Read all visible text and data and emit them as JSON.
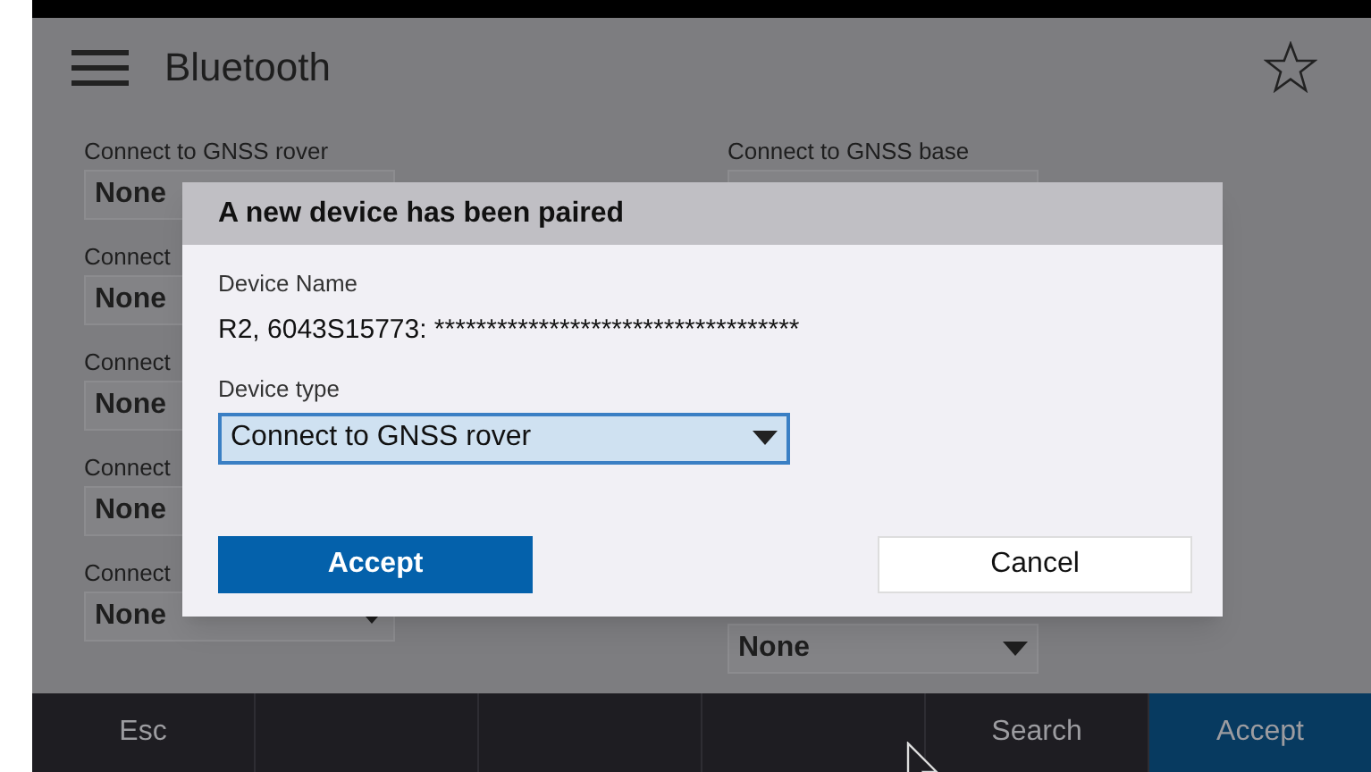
{
  "header": {
    "title": "Bluetooth"
  },
  "left_fields": [
    {
      "label": "Connect to GNSS rover",
      "value": "None"
    },
    {
      "label": "Connect",
      "value": "None"
    },
    {
      "label": "Connect",
      "value": "None"
    },
    {
      "label": "Connect",
      "value": "None"
    },
    {
      "label": "Connect",
      "value": "None"
    }
  ],
  "right_fields": [
    {
      "kind": "labelled",
      "label": "Connect to GNSS base"
    },
    {
      "kind": "bottom",
      "value": "None"
    }
  ],
  "dialog": {
    "title": "A new device has been paired",
    "name_label": "Device Name",
    "name_value": "R2, 6043S15773: ***********************************",
    "type_label": "Device type",
    "type_value": "Connect to GNSS rover",
    "accept": "Accept",
    "cancel": "Cancel"
  },
  "bottom_bar": [
    {
      "label": "Esc",
      "selected": false
    },
    {
      "selected": false
    },
    {
      "selected": false
    },
    {
      "selected": false
    },
    {
      "label": "Search",
      "selected": false
    },
    {
      "label": "Accept",
      "selected": true
    }
  ]
}
